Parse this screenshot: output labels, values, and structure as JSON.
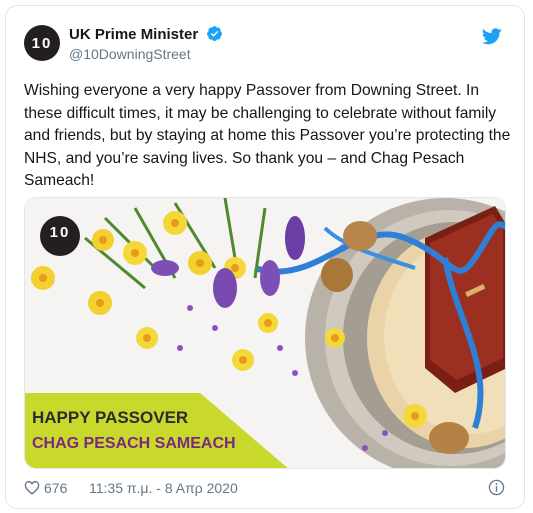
{
  "author": {
    "display_name": "UK Prime Minister",
    "handle": "@10DowningStreet",
    "avatar_text": "10",
    "verified": true
  },
  "tweet": {
    "text": "Wishing everyone a very happy Passover from Downing Street. In these difficult times, it may be challenging to celebrate without family and friends, but by staying at home this Passover you’re protecting the NHS, and you’re saving lives. So thank you – and Chag Pesach Sameach!"
  },
  "media": {
    "logo_text": "10",
    "banner_line1": "HAPPY PASSOVER",
    "banner_line2": "CHAG PESACH SAMEACH"
  },
  "footer": {
    "like_count": "676",
    "timestamp": "11:35 π.μ. - 8 Απρ 2020"
  },
  "colors": {
    "twitter_blue": "#1da1f2",
    "verified_blue": "#1da1f2",
    "banner_green": "#c9d92b",
    "banner_text_dark": "#2b2b2b",
    "banner_text_purple": "#7a2a7e",
    "secondary_text": "#657786"
  },
  "icons": [
    "verified-badge-icon",
    "twitter-bird-icon",
    "heart-icon",
    "info-icon"
  ]
}
